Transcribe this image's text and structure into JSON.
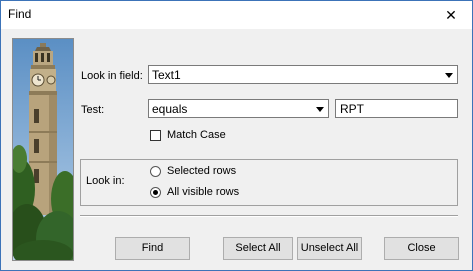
{
  "window": {
    "title": "Find",
    "close_glyph": "✕"
  },
  "form": {
    "look_in_field_label": "Look in field:",
    "look_in_field_value": "Text1",
    "test_label": "Test:",
    "test_value": "equals",
    "search_value": "RPT",
    "match_case_label": "Match Case",
    "match_case_checked": false,
    "look_in_label": "Look in:",
    "options": [
      {
        "label": "Selected rows",
        "selected": false
      },
      {
        "label": "All visible rows",
        "selected": true
      }
    ]
  },
  "buttons": {
    "find": "Find",
    "select_all": "Select All",
    "unselect_all": "Unselect All",
    "close": "Close"
  },
  "icons": {
    "dropdown": "chevron-down-icon",
    "close": "close-icon",
    "image": "clock-tower-photo"
  }
}
